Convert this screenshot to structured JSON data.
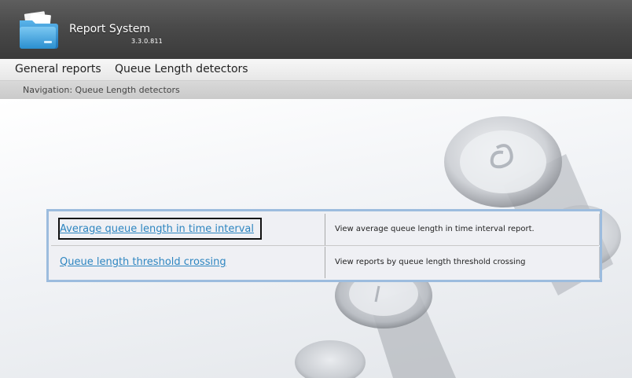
{
  "app": {
    "title": "Report System",
    "version": "3.3.0.811"
  },
  "menu": {
    "items": [
      {
        "label": "General reports"
      },
      {
        "label": "Queue Length detectors"
      }
    ]
  },
  "navigation": {
    "text": "Navigation: Queue Length detectors"
  },
  "reports": [
    {
      "link": "Average queue length in time interval",
      "description": "View average queue length in time interval report."
    },
    {
      "link": "Queue length threshold crossing",
      "description": "View reports by queue length threshold crossing"
    }
  ],
  "colors": {
    "link": "#2e86c1",
    "table_border": "#9cbcde",
    "header": "#4a4a4a"
  },
  "icons": {
    "logo": "folder-icon"
  }
}
